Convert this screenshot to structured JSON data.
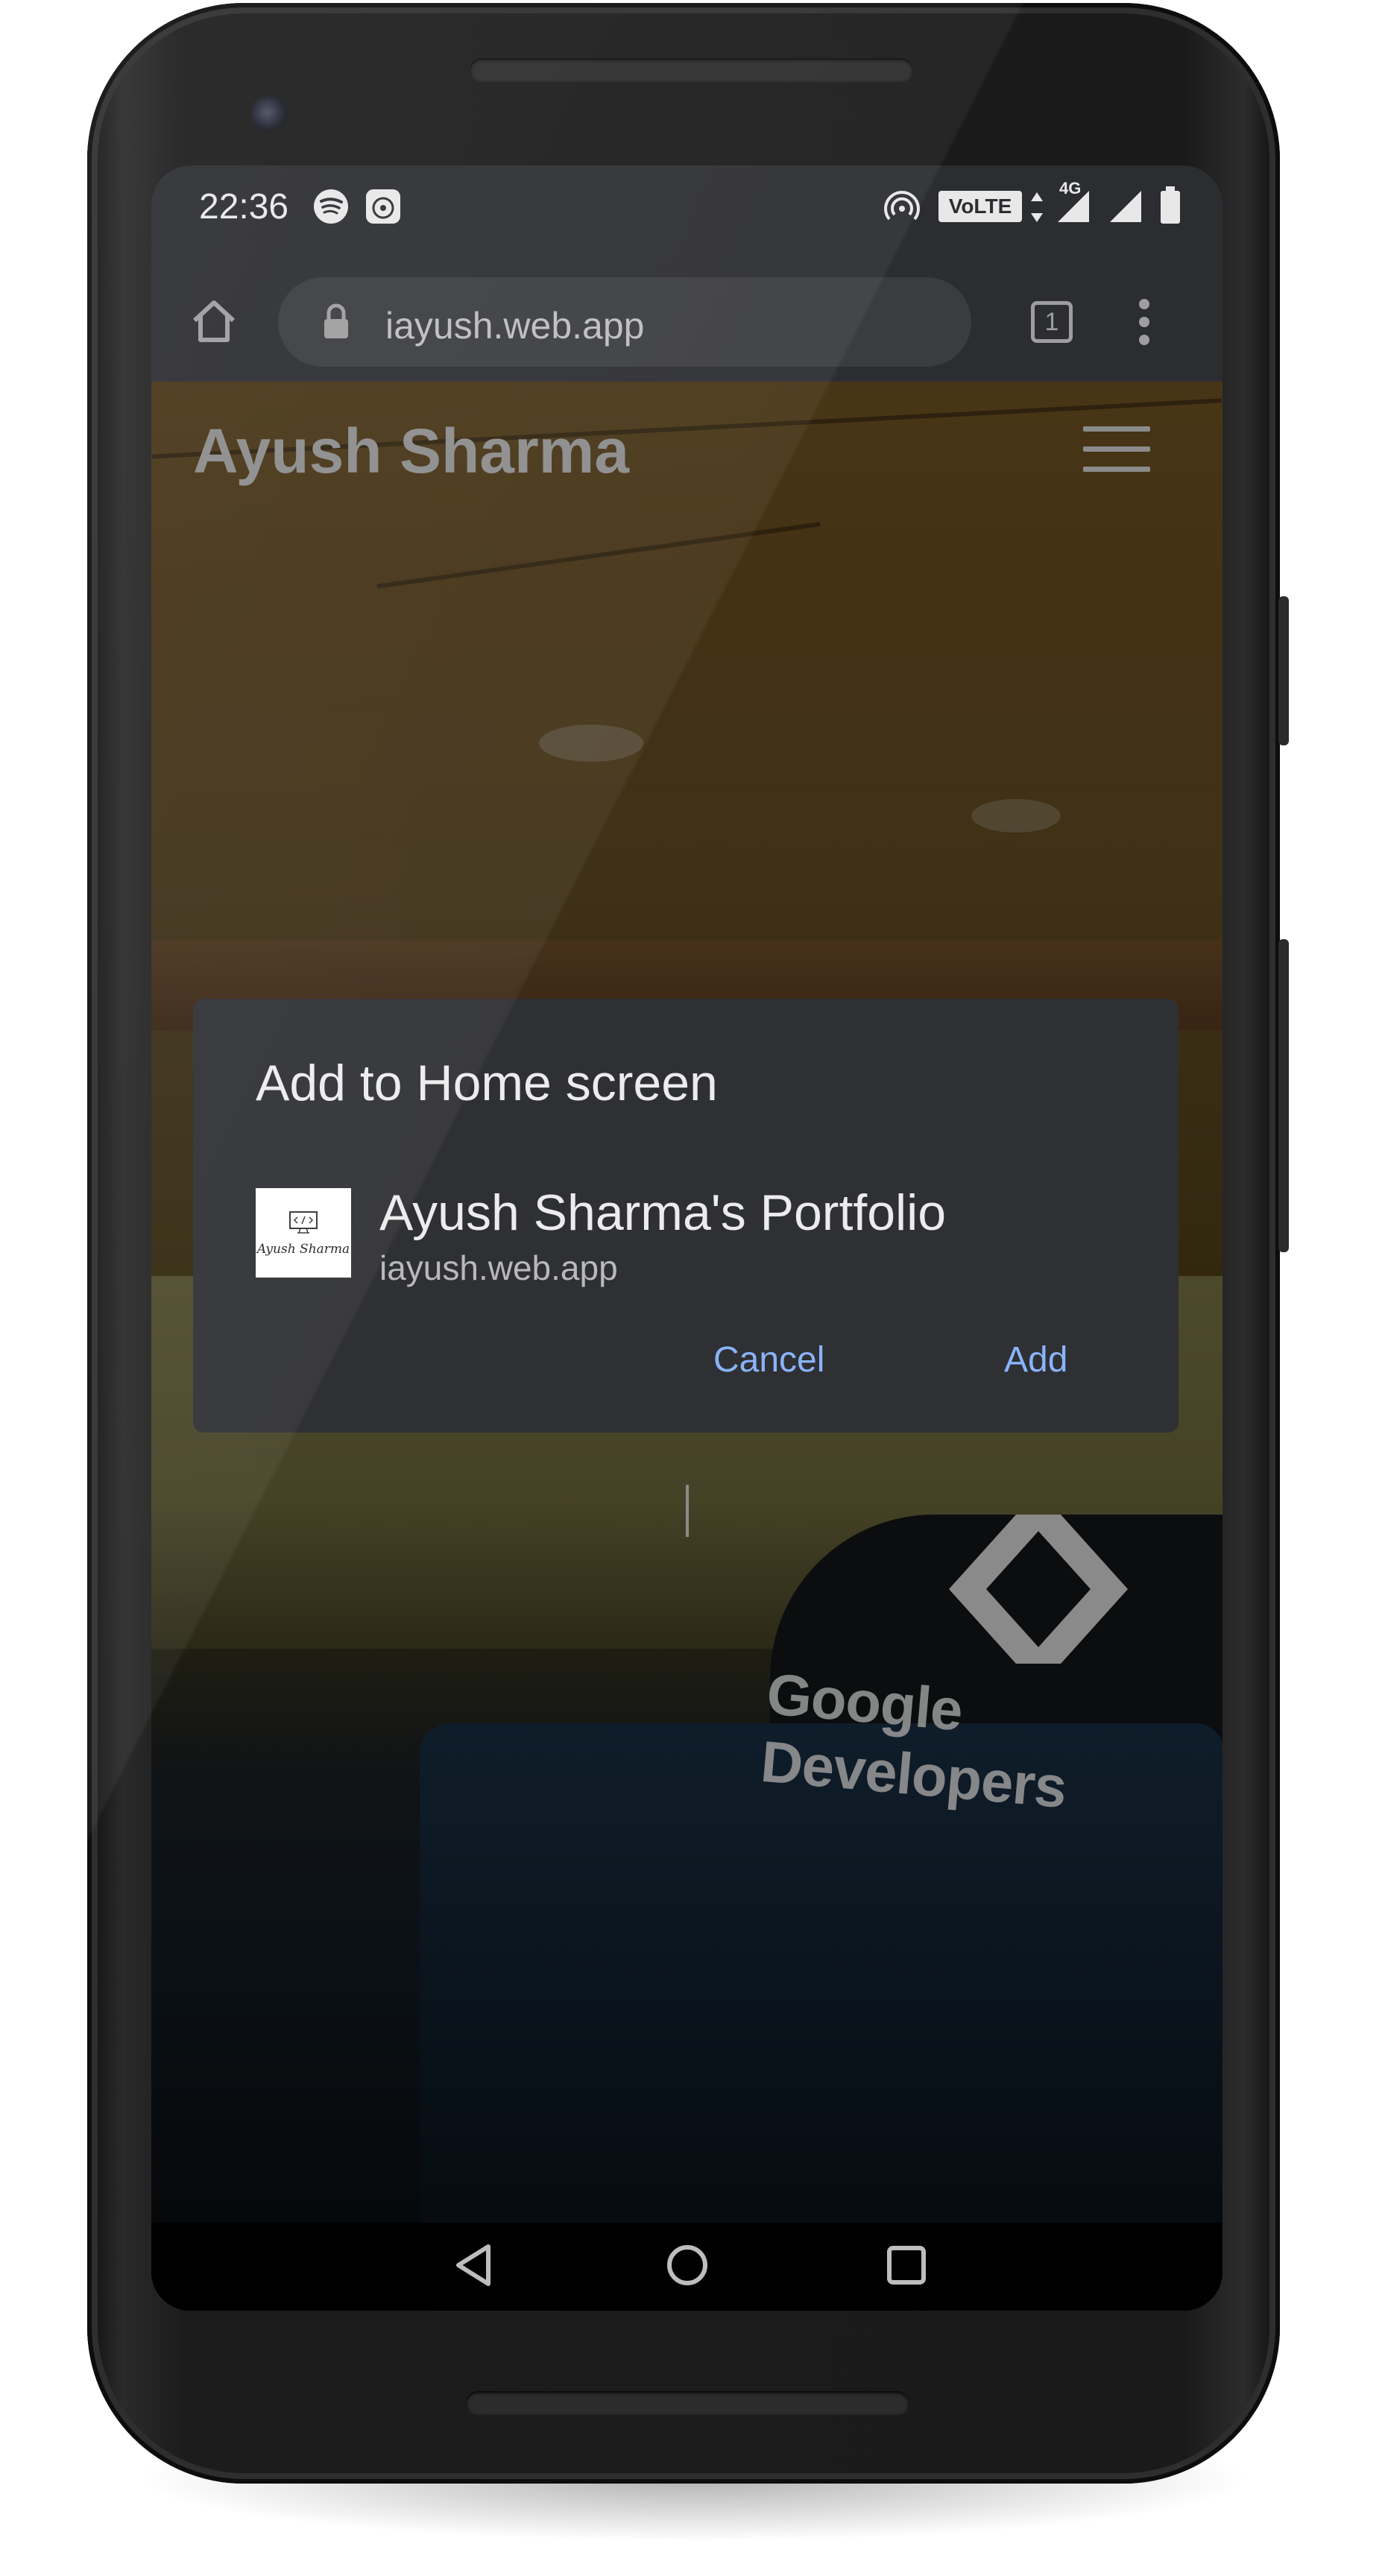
{
  "status_bar": {
    "time": "22:36",
    "left_icons": [
      "spotify-icon",
      "notification-app-icon"
    ],
    "right_icons": [
      "hotspot-icon",
      "volte-icon",
      "data-arrows-icon",
      "signal-4g-icon",
      "signal-icon",
      "battery-icon"
    ],
    "volte_label": "VoLTE",
    "network_label": "4G"
  },
  "browser": {
    "url": "iayush.web.app",
    "tab_count": "1",
    "home_icon": "home-icon",
    "lock_icon": "lock-icon",
    "menu_icon": "more-vert-icon"
  },
  "page": {
    "site_title": "Ayush Sharma",
    "menu_icon": "hamburger-icon",
    "background_text": "Google Developers"
  },
  "dialog": {
    "title": "Add to Home screen",
    "app_name": "Ayush Sharma's Portfolio",
    "app_url": "iayush.web.app",
    "app_icon_caption": "Ayush Sharma",
    "cancel_label": "Cancel",
    "add_label": "Add",
    "accent_color": "#8ab4f8"
  },
  "nav_bar": {
    "back_icon": "back-icon",
    "home_icon": "home-circle-icon",
    "recents_icon": "recents-icon"
  }
}
